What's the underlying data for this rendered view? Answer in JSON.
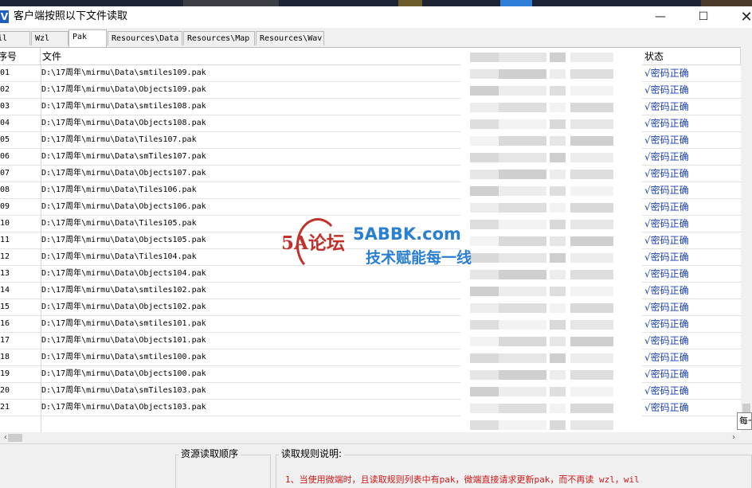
{
  "window": {
    "title": "客户端按照以下文件读取",
    "app_icon_letter": "V",
    "minimize": "—",
    "maximize": "☐",
    "close": "✕"
  },
  "tabs": [
    {
      "label": "Wil"
    },
    {
      "label": "Wzl"
    },
    {
      "label": "Pak",
      "active": true
    },
    {
      "label": "Resources\\Data"
    },
    {
      "label": "Resources\\Map"
    },
    {
      "label": "Resources\\Wav"
    }
  ],
  "table": {
    "headers": {
      "num": "序号",
      "file": "文件",
      "status": "状态"
    },
    "rows": [
      {
        "num": "01",
        "file": "D:\\17周年\\mirmu\\Data\\smtiles109.pak",
        "status": "√密码正确"
      },
      {
        "num": "02",
        "file": "D:\\17周年\\mirmu\\Data\\Objects109.pak",
        "status": "√密码正确"
      },
      {
        "num": "03",
        "file": "D:\\17周年\\mirmu\\Data\\smtiles108.pak",
        "status": "√密码正确"
      },
      {
        "num": "04",
        "file": "D:\\17周年\\mirmu\\Data\\Objects108.pak",
        "status": "√密码正确"
      },
      {
        "num": "05",
        "file": "D:\\17周年\\mirmu\\Data\\Tiles107.pak",
        "status": "√密码正确"
      },
      {
        "num": "06",
        "file": "D:\\17周年\\mirmu\\Data\\smTiles107.pak",
        "status": "√密码正确"
      },
      {
        "num": "07",
        "file": "D:\\17周年\\mirmu\\Data\\Objects107.pak",
        "status": "√密码正确"
      },
      {
        "num": "08",
        "file": "D:\\17周年\\mirmu\\Data\\Tiles106.pak",
        "status": "√密码正确"
      },
      {
        "num": "09",
        "file": "D:\\17周年\\mirmu\\Data\\Objects106.pak",
        "status": "√密码正确"
      },
      {
        "num": "10",
        "file": "D:\\17周年\\mirmu\\Data\\Tiles105.pak",
        "status": "√密码正确"
      },
      {
        "num": "11",
        "file": "D:\\17周年\\mirmu\\Data\\Objects105.pak",
        "status": "√密码正确"
      },
      {
        "num": "12",
        "file": "D:\\17周年\\mirmu\\Data\\Tiles104.pak",
        "status": "√密码正确"
      },
      {
        "num": "13",
        "file": "D:\\17周年\\mirmu\\Data\\Objects104.pak",
        "status": "√密码正确"
      },
      {
        "num": "14",
        "file": "D:\\17周年\\mirmu\\Data\\smtiles102.pak",
        "status": "√密码正确"
      },
      {
        "num": "15",
        "file": "D:\\17周年\\mirmu\\Data\\Objects102.pak",
        "status": "√密码正确"
      },
      {
        "num": "16",
        "file": "D:\\17周年\\mirmu\\Data\\smtiles101.pak",
        "status": "√密码正确"
      },
      {
        "num": "17",
        "file": "D:\\17周年\\mirmu\\Data\\Objects101.pak",
        "status": "√密码正确"
      },
      {
        "num": "18",
        "file": "D:\\17周年\\mirmu\\Data\\smtiles100.pak",
        "status": "√密码正确"
      },
      {
        "num": "19",
        "file": "D:\\17周年\\mirmu\\Data\\Objects100.pak",
        "status": "√密码正确"
      },
      {
        "num": "20",
        "file": "D:\\17周年\\mirmu\\Data\\smTiles103.pak",
        "status": "√密码正确"
      },
      {
        "num": "21",
        "file": "D:\\17周年\\mirmu\\Data\\Objects103.pak",
        "status": "√密码正确"
      }
    ]
  },
  "watermark": {
    "logo_text": "5A论坛",
    "site": "5ABBK.com",
    "slogan": "技术赋能每一线"
  },
  "tooltip": "每一",
  "bottom": {
    "resource_order_label": "资源读取顺序",
    "rules_label": "读取规则说明:",
    "rule_line_1": "1、当使用微端时，且读取规则列表中有pak，微端直接请求更新pak，而不再读 wzl，wil"
  },
  "colors": {
    "status_text": "#1a3fb5",
    "rule_text": "#d01818",
    "watermark_blue": "#2b7fd1",
    "watermark_red": "#c0322b"
  }
}
